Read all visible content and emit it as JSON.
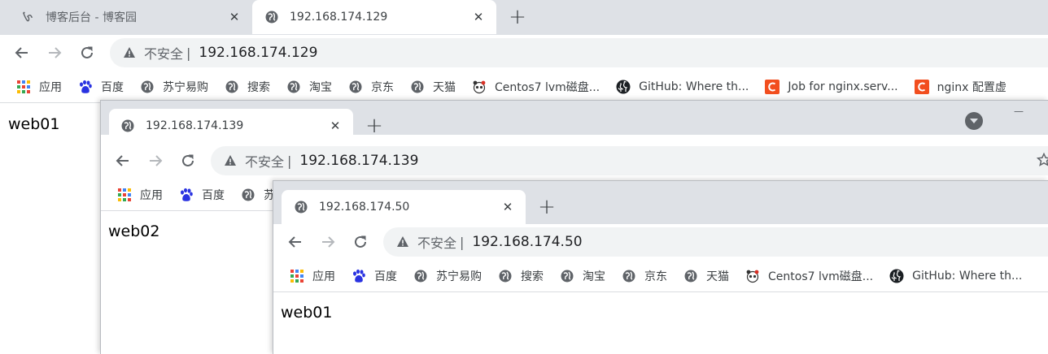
{
  "window1": {
    "tabs": [
      {
        "title": "博客后台 - 博客园",
        "icon": "cnblogs-icon"
      },
      {
        "title": "192.168.174.129",
        "icon": "globe-icon"
      }
    ],
    "omnibox": {
      "not_secure": "不安全",
      "separator": "|",
      "url": "192.168.174.129"
    },
    "bookmarks": [
      "应用",
      "百度",
      "苏宁易购",
      "搜索",
      "淘宝",
      "京东",
      "天猫",
      "Centos7 lvm磁盘...",
      "GitHub: Where th...",
      "Job for nginx.serv...",
      "nginx 配置虚"
    ],
    "page_text": "web01"
  },
  "window2": {
    "tabs": [
      {
        "title": "192.168.174.139",
        "icon": "globe-icon"
      }
    ],
    "omnibox": {
      "not_secure": "不安全",
      "separator": "|",
      "url": "192.168.174.139"
    },
    "bookmarks": [
      "应用",
      "百度",
      "苏"
    ],
    "page_text": "web02",
    "minimize_label": "—"
  },
  "window3": {
    "tabs": [
      {
        "title": "192.168.174.50",
        "icon": "globe-icon"
      }
    ],
    "omnibox": {
      "not_secure": "不安全",
      "separator": "|",
      "url": "192.168.174.50"
    },
    "bookmarks": [
      "应用",
      "百度",
      "苏宁易购",
      "搜索",
      "淘宝",
      "京东",
      "天猫",
      "Centos7 lvm磁盘...",
      "GitHub: Where th..."
    ],
    "page_text": "web01"
  },
  "colors": {
    "tabstrip": "#dee1e6",
    "omnibox": "#f1f3f4",
    "baidu": "#2932e1",
    "red_c": "#f24e1e",
    "github": "#1b1f23"
  }
}
